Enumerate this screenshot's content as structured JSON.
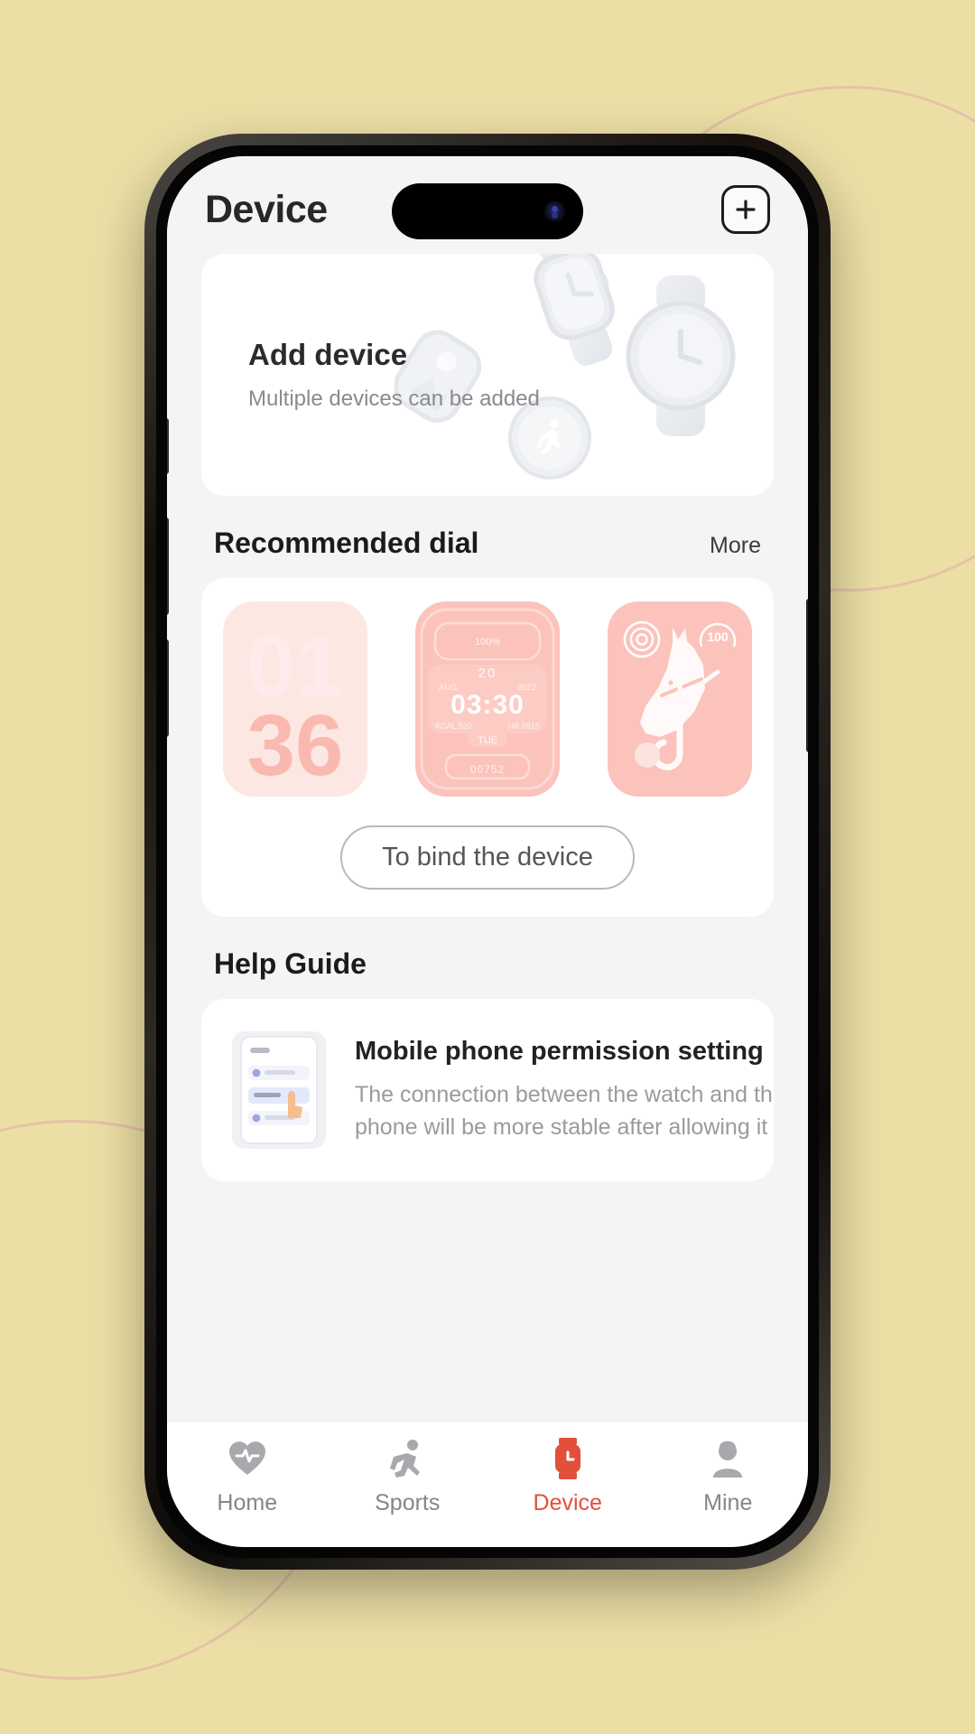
{
  "header": {
    "title": "Device",
    "add_button_icon": "plus-icon"
  },
  "add_device_card": {
    "title": "Add device",
    "subtitle": "Multiple devices can be added"
  },
  "recommended_dial": {
    "section_title": "Recommended dial",
    "more_label": "More",
    "bind_button_label": "To bind the device",
    "dials": [
      {
        "name": "big-numerals-dial",
        "line1": "01",
        "line2": "36",
        "style": "pale"
      },
      {
        "name": "digital-data-dial",
        "time": "03:30",
        "day_number": "20",
        "month": "AUG",
        "year": "2022",
        "kcal": "KCAL 520",
        "hr": "HR 0915",
        "weekday": "TUE",
        "battery": "100%",
        "steps": "00752",
        "style": "solid"
      },
      {
        "name": "horse-analog-dial",
        "badge": "100",
        "style": "solid"
      }
    ]
  },
  "help_guide": {
    "section_title": "Help Guide",
    "items": [
      {
        "title": "Mobile phone permission setting",
        "description": "The connection between the watch and the phone will be more stable after allowing it"
      }
    ]
  },
  "tabbar": {
    "active_color": "#e2503c",
    "inactive_color": "#85858a",
    "tabs": [
      {
        "label": "Home",
        "icon": "heart-pulse-icon",
        "active": false
      },
      {
        "label": "Sports",
        "icon": "runner-icon",
        "active": false
      },
      {
        "label": "Device",
        "icon": "watch-icon",
        "active": true
      },
      {
        "label": "Mine",
        "icon": "person-icon",
        "active": false
      }
    ]
  },
  "theme": {
    "background": "#ecdfa6",
    "screen_background": "#f4f4f4",
    "card_background": "#ffffff",
    "dial_accent": "#fbc3bb"
  }
}
